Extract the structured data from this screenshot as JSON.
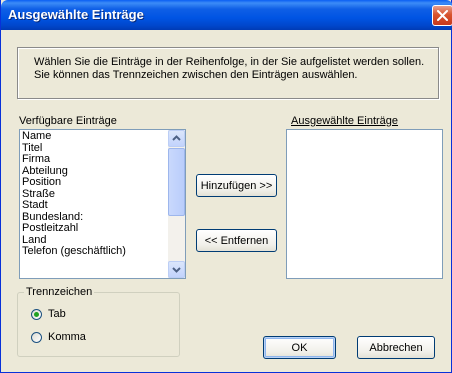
{
  "window": {
    "title": "Ausgewählte Einträge"
  },
  "info": {
    "text_line1": "Wählen Sie die Einträge in der Reihenfolge, in der Sie aufgelistet werden sollen.",
    "text_line2": "Sie können das Trennzeichen zwischen den Einträgen auswählen."
  },
  "available": {
    "label": "Verfügbare Einträge",
    "items": [
      "Name",
      "Titel",
      "Firma",
      "Abteilung",
      "Position",
      "Straße",
      "Stadt",
      "Bundesland:",
      "Postleitzahl",
      "Land",
      "Telefon (geschäftlich)"
    ]
  },
  "selected": {
    "label": "Ausgewählte Einträge",
    "items": []
  },
  "buttons": {
    "add": "Hinzufügen >>",
    "remove": "<< Entfernen",
    "ok": "OK",
    "cancel": "Abbrechen"
  },
  "separator": {
    "label": "Trennzeichen",
    "options": [
      {
        "label": "Tab",
        "checked": true
      },
      {
        "label": "Komma",
        "checked": false
      }
    ]
  },
  "colors": {
    "titlebar": "#0054e3",
    "dialog_bg": "#ece9d8",
    "close_button": "#d8542e",
    "radio_checked": "#21a121"
  },
  "icons": {
    "close": "close-icon",
    "scroll_up": "chevron-up-icon",
    "scroll_down": "chevron-down-icon"
  }
}
